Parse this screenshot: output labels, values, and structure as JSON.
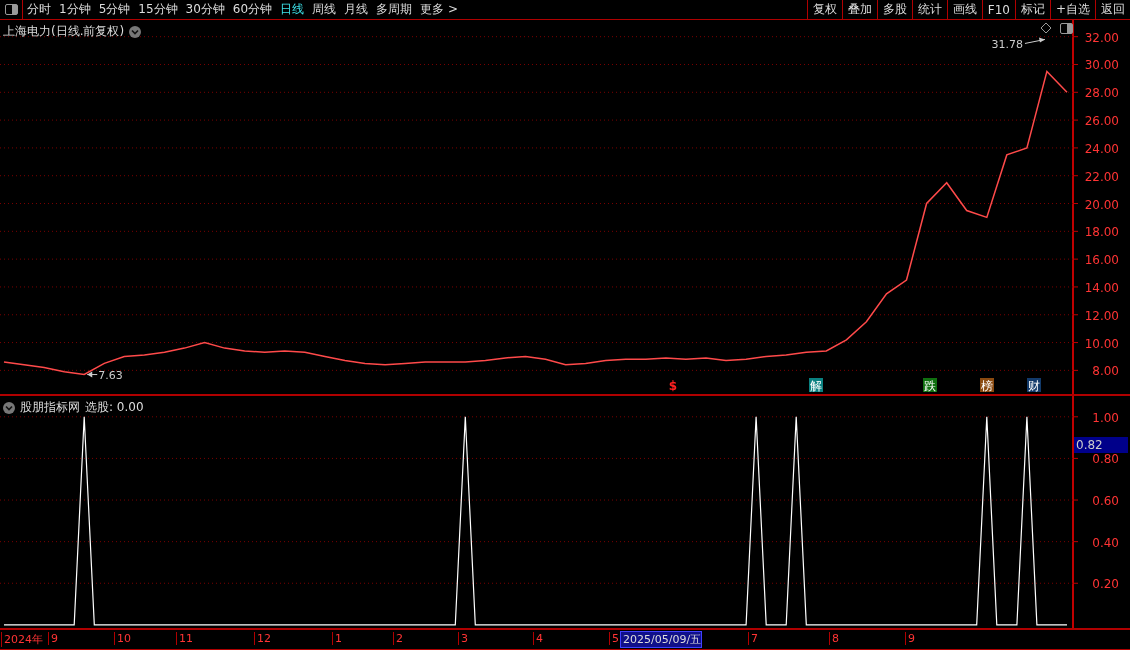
{
  "toolbar": {
    "periods": [
      {
        "label": "分时",
        "selected": false
      },
      {
        "label": "1分钟",
        "selected": false
      },
      {
        "label": "5分钟",
        "selected": false
      },
      {
        "label": "15分钟",
        "selected": false
      },
      {
        "label": "30分钟",
        "selected": false
      },
      {
        "label": "60分钟",
        "selected": false
      },
      {
        "label": "日线",
        "selected": true
      },
      {
        "label": "周线",
        "selected": false
      },
      {
        "label": "月线",
        "selected": false
      },
      {
        "label": "多周期",
        "selected": false
      },
      {
        "label": "更多 >",
        "selected": false
      }
    ],
    "buttons": [
      "复权",
      "叠加",
      "多股",
      "统计",
      "画线",
      "F10",
      "标记",
      "+自选",
      "返回"
    ]
  },
  "main_panel": {
    "title": "上海电力(日线.前复权)",
    "chart_data": {
      "type": "line",
      "grid": true,
      "series": [
        {
          "color": "#ff4a4a",
          "values": [
            8.6,
            8.4,
            8.2,
            7.9,
            7.7,
            8.5,
            9.0,
            9.1,
            9.3,
            9.6,
            10.0,
            9.6,
            9.4,
            9.3,
            9.4,
            9.3,
            9.0,
            8.7,
            8.5,
            8.4,
            8.5,
            8.6,
            8.6,
            8.6,
            8.7,
            8.9,
            9.0,
            8.8,
            8.4,
            8.5,
            8.7,
            8.8,
            8.8,
            8.9,
            8.8,
            8.9,
            8.7,
            8.8,
            9.0,
            9.1,
            9.3,
            9.4,
            10.2,
            11.5,
            13.5,
            14.5,
            20.0,
            21.5,
            19.5,
            19.0,
            23.5,
            24.0,
            29.5,
            28.0
          ]
        }
      ],
      "yticks": [
        {
          "value": 8,
          "label": "8.00"
        },
        {
          "value": 10,
          "label": "10.00"
        },
        {
          "value": 12,
          "label": "12.00"
        },
        {
          "value": 14,
          "label": "14.00"
        },
        {
          "value": 16,
          "label": "16.00"
        },
        {
          "value": 18,
          "label": "18.00"
        },
        {
          "value": 20,
          "label": "20.00"
        },
        {
          "value": 22,
          "label": "22.00"
        },
        {
          "value": 24,
          "label": "24.00"
        },
        {
          "value": 26,
          "label": "26.00"
        },
        {
          "value": 28,
          "label": "28.00"
        },
        {
          "value": 30,
          "label": "30.00"
        },
        {
          "value": 32,
          "label": "32.00"
        }
      ],
      "ylim": [
        6.3,
        33.2
      ],
      "annotations": [
        "31.78",
        "7.63"
      ]
    },
    "events": [
      {
        "label": "$",
        "kind": "plain",
        "color": "#ff2020"
      },
      {
        "label": "解",
        "kind": "badge",
        "color": "#0a8080"
      },
      {
        "label": "跌",
        "kind": "badge",
        "color": "#107010"
      },
      {
        "label": "榜",
        "kind": "badge",
        "color": "#8a4a10"
      },
      {
        "label": "财",
        "kind": "badge",
        "color": "#123a6a"
      }
    ]
  },
  "indicator_panel": {
    "name": "股朋指标网",
    "reading": "选股: 0.00",
    "cursor_value": "0.82",
    "chart_data": {
      "type": "line",
      "grid": true,
      "ylim": [
        -0.015,
        1.1
      ],
      "series": [
        {
          "color": "#ffffff",
          "values": [
            0,
            0,
            0,
            0,
            0,
            0,
            0,
            0,
            1,
            0,
            0,
            0,
            0,
            0,
            0,
            0,
            0,
            0,
            0,
            0,
            0,
            0,
            0,
            0,
            0,
            0,
            0,
            0,
            0,
            0,
            0,
            0,
            0,
            0,
            0,
            0,
            0,
            0,
            0,
            0,
            0,
            0,
            0,
            0,
            0,
            0,
            1,
            0,
            0,
            0,
            0,
            0,
            0,
            0,
            0,
            0,
            0,
            0,
            0,
            0,
            0,
            0,
            0,
            0,
            0,
            0,
            0,
            0,
            0,
            0,
            0,
            0,
            0,
            0,
            0,
            1,
            0,
            0,
            0,
            1,
            0,
            0,
            0,
            0,
            0,
            0,
            0,
            0,
            0,
            0,
            0,
            0,
            0,
            0,
            0,
            0,
            0,
            0,
            1,
            0,
            0,
            0,
            1,
            0,
            0,
            0,
            0
          ]
        }
      ],
      "yticks": [
        {
          "value": 0.2,
          "label": "0.20"
        },
        {
          "value": 0.4,
          "label": "0.40"
        },
        {
          "value": 0.6,
          "label": "0.60"
        },
        {
          "value": 0.8,
          "label": "0.80"
        },
        {
          "value": 1.0,
          "label": "1.00"
        }
      ]
    }
  },
  "x_axis": [
    {
      "label": "2024年",
      "highlighted": false
    },
    {
      "label": "9",
      "highlighted": false
    },
    {
      "label": "10",
      "highlighted": false
    },
    {
      "label": "11",
      "highlighted": false
    },
    {
      "label": "12",
      "highlighted": false
    },
    {
      "label": "1",
      "highlighted": false
    },
    {
      "label": "2",
      "highlighted": false
    },
    {
      "label": "3",
      "highlighted": false
    },
    {
      "label": "4",
      "highlighted": false
    },
    {
      "label": "5",
      "highlighted": false
    },
    {
      "label": "2025/05/09/五",
      "highlighted": true
    },
    {
      "label": "7",
      "highlighted": false
    },
    {
      "label": "8",
      "highlighted": false
    },
    {
      "label": "9",
      "highlighted": false
    }
  ]
}
